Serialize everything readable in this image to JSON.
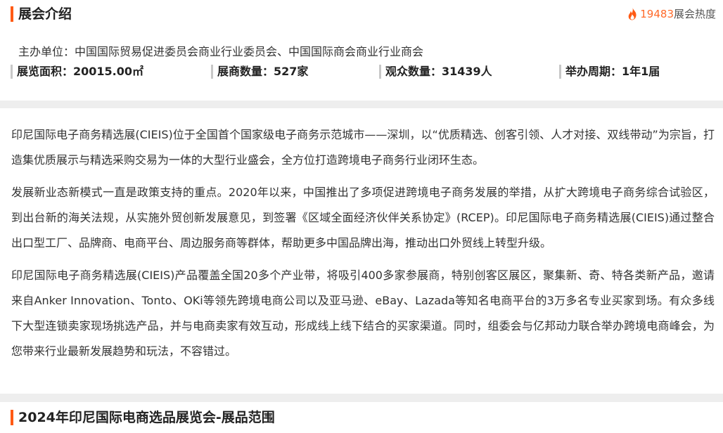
{
  "section": {
    "title": "展会介绍",
    "heat_value": "19483",
    "heat_label": "展会热度",
    "accent": "#ff5a14"
  },
  "organizer": "主办单位：中国国际贸易促进委员会商业行业委员会、中国国际商会商业行业商会",
  "stats": [
    "展览面积：20015.00㎡",
    "展商数量：527家",
    "观众数量：31439人",
    "举办周期：1年1届"
  ],
  "paragraphs": [
    "印尼国际电子商务精选展(CIEIS)位于全国首个国家级电子商务示范城市——深圳，以“优质精选、创客引领、人才对接、双线带动”为宗旨，打造集优质展示与精选采购交易为一体的大型行业盛会，全方位打造跨境电子商务行业闭环生态。",
    "发展新业态新模式一直是政策支持的重点。2020年以来，中国推出了多项促进跨境电子商务发展的举措，从扩大跨境电子商务综合试验区，到出台新的海关法规，从实施外贸创新发展意见，到签署《区域全面经济伙伴关系协定》(RCEP)。印尼国际电子商务精选展(CIEIS)通过整合出口型工厂、品牌商、电商平台、周边服务商等群体，帮助更多中国品牌出海，推动出口外贸线上转型升级。",
    "印尼国际电子商务精选展(CIEIS)产品覆盖全国20多个产业带，将吸引400多家参展商，特别创客区展区，聚集新、奇、特各类新产品，邀请来自Anker Innovation、Tonto、OKi等领先跨境电商公司以及亚马逊、eBay、Lazada等知名电商平台的3万多名专业买家到场。有众多线下大型连锁卖家现场挑选产品，并与电商卖家有效互动，形成线上线下结合的买家渠道。同时，组委会与亿邦动力联合举办跨境电商峰会，为您带来行业最新发展趋势和玩法，不容错过。"
  ],
  "next_section": {
    "title": "2024年印尼国际电商选品展览会-展品范围"
  },
  "icons": {
    "heat": "flame-icon"
  }
}
